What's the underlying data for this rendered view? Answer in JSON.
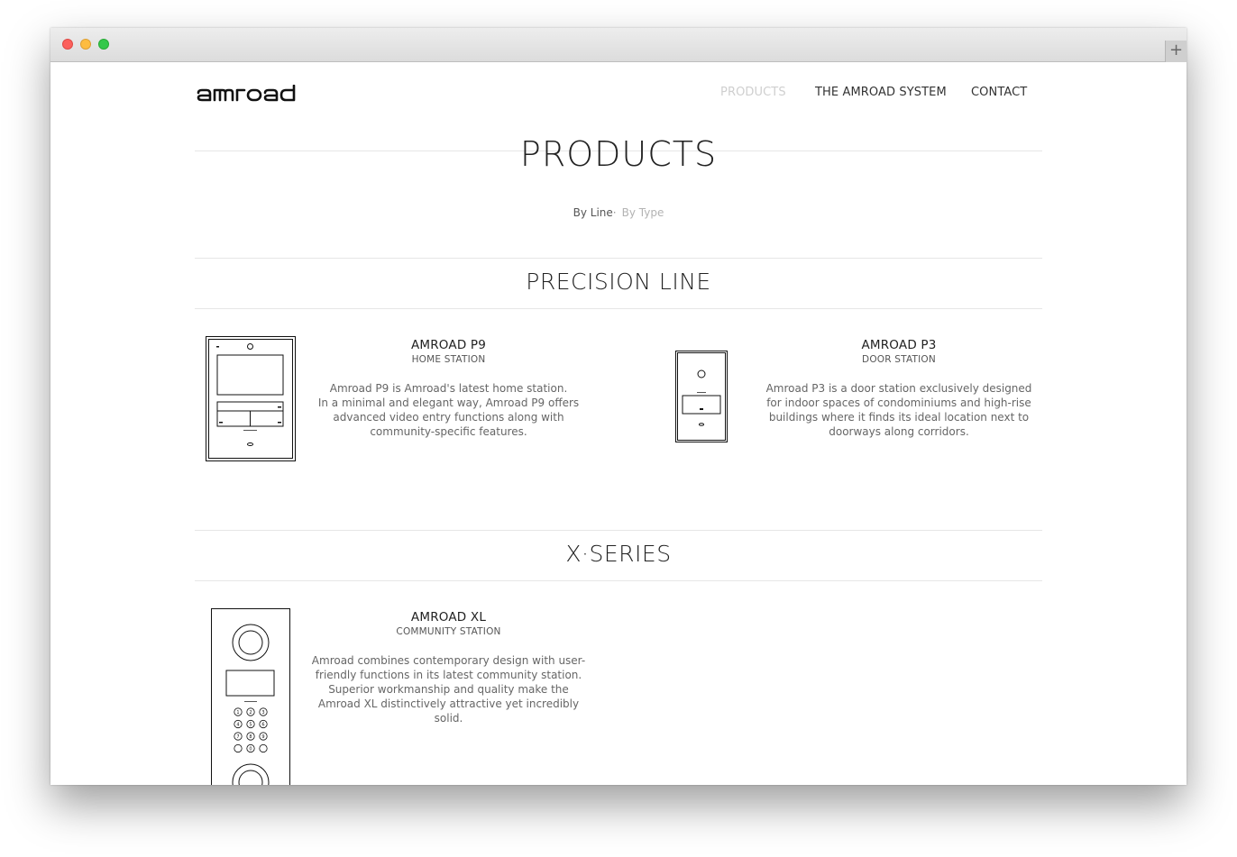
{
  "brand": {
    "logo_text": "amroad"
  },
  "nav": {
    "products": "PRODUCTS",
    "system": "THE AMROAD SYSTEM",
    "contact": "CONTACT"
  },
  "page": {
    "title": "PRODUCTS"
  },
  "filters": {
    "by_line": "By Line",
    "separator": "·",
    "by_type": "By Type"
  },
  "sections": [
    {
      "title": "PRECISION LINE",
      "products": [
        {
          "name": "AMROAD P9",
          "type": "HOME STATION",
          "description": "Amroad P9 is Amroad's latest home station.\nIn a minimal and elegant way, Amroad P9 offers advanced video entry functions along with community-specific features.",
          "icon": "home-station-drawing"
        },
        {
          "name": "AMROAD P3",
          "type": "DOOR STATION",
          "description": "Amroad P3 is a door station exclusively designed for indoor spaces of condominiums and high-rise buildings where it finds its ideal location next to doorways along corridors.",
          "icon": "door-station-drawing"
        }
      ]
    },
    {
      "title": "X·SERIES",
      "products": [
        {
          "name": "AMROAD XL",
          "type": "COMMUNITY STATION",
          "description": "Amroad combines contemporary design with user-friendly functions in its latest community station. Superior workmanship and quality make the Amroad XL distinctively attractive yet incredibly solid.",
          "icon": "community-station-drawing"
        }
      ]
    }
  ],
  "keypad": [
    "1",
    "2",
    "3",
    "4",
    "5",
    "6",
    "7",
    "8",
    "9",
    "",
    "0",
    ""
  ],
  "colors": {
    "nav_active": "#cfcfcf",
    "text": "#333333",
    "rule": "#e6e6e6"
  }
}
